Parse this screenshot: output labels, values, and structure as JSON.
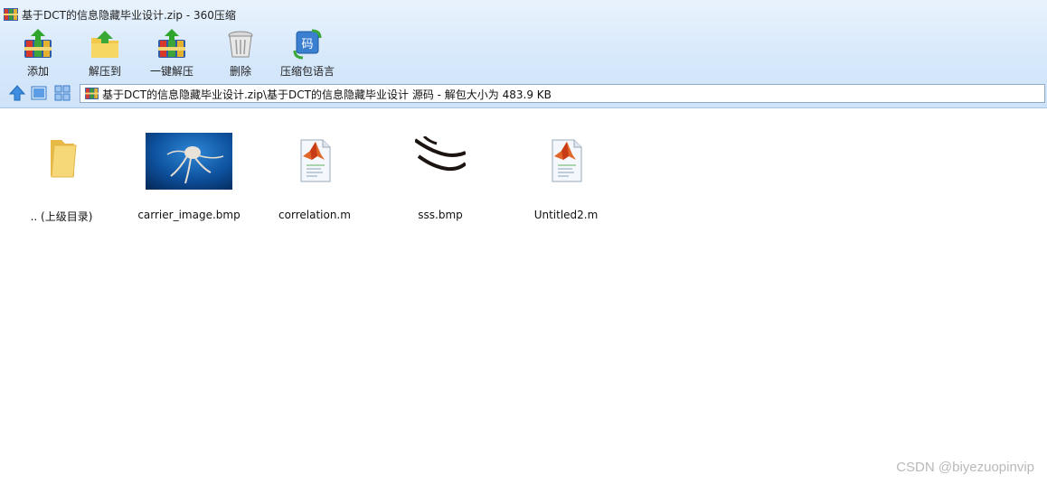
{
  "window": {
    "title": "基于DCT的信息隐藏毕业设计.zip - 360压缩"
  },
  "toolbar": {
    "buttons": [
      {
        "label": "添加",
        "icon": "archive-add-icon"
      },
      {
        "label": "解压到",
        "icon": "extract-to-icon"
      },
      {
        "label": "一键解压",
        "icon": "one-click-extract-icon"
      },
      {
        "label": "删除",
        "icon": "trash-icon"
      },
      {
        "label": "压缩包语言",
        "icon": "language-code-icon"
      }
    ]
  },
  "navbar": {
    "path": "基于DCT的信息隐藏毕业设计.zip\\基于DCT的信息隐藏毕业设计 源码 - 解包大小为 483.9 KB"
  },
  "files": [
    {
      "name": ".. (上级目录)",
      "icon": "folder-icon"
    },
    {
      "name": "carrier_image.bmp",
      "icon": "image-thumbnail"
    },
    {
      "name": "correlation.m",
      "icon": "matlab-file-icon"
    },
    {
      "name": "sss.bmp",
      "icon": "image-thumbnail"
    },
    {
      "name": "Untitled2.m",
      "icon": "matlab-file-icon"
    }
  ],
  "watermark": "CSDN @biyezuopinvip"
}
